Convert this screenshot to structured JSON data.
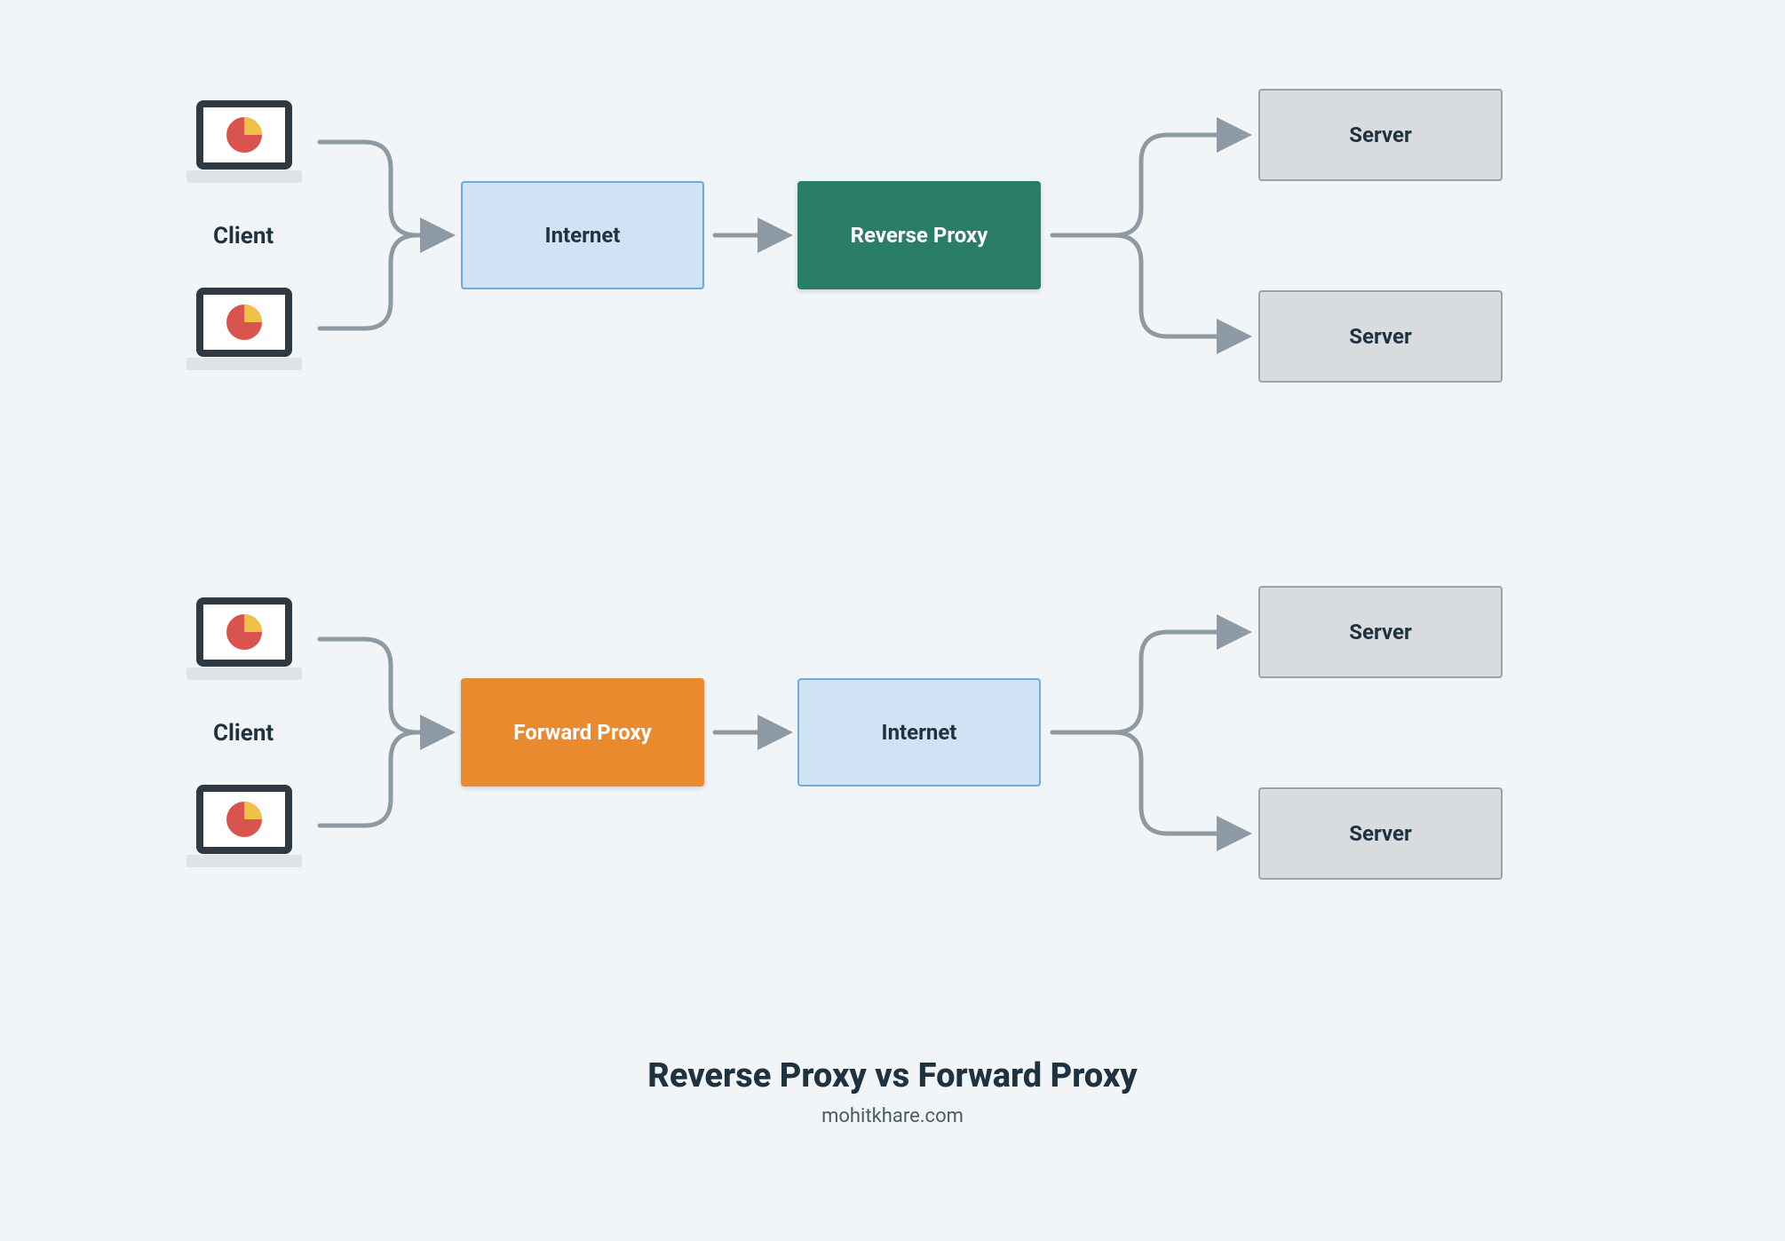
{
  "diagram": {
    "title": "Reverse Proxy vs Forward Proxy",
    "attribution": "mohitkhare.com",
    "top": {
      "client_label": "Client",
      "box1": "Internet",
      "box2": "Reverse Proxy",
      "server_top": "Server",
      "server_bottom": "Server"
    },
    "bottom": {
      "client_label": "Client",
      "box1": "Forward Proxy",
      "box2": "Internet",
      "server_top": "Server",
      "server_bottom": "Server"
    }
  }
}
